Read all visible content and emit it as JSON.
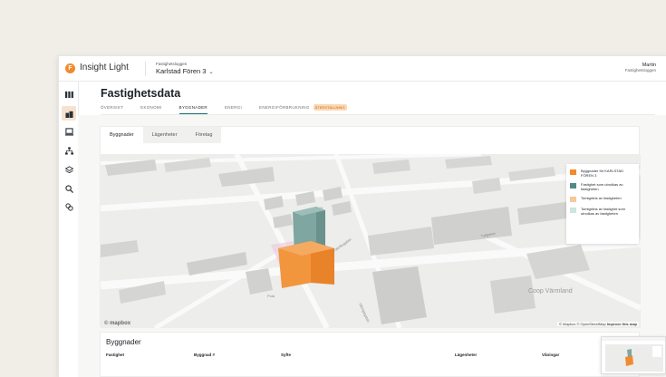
{
  "app": {
    "name": "Insight Light",
    "logo_letter": "F"
  },
  "property": {
    "org": "Fastighetsloggen",
    "name": "Karlstad Fören 3"
  },
  "user": {
    "name": "Martin",
    "org": "Fastighetsloggen"
  },
  "page": {
    "title": "Fastighetsdata"
  },
  "tabs": [
    {
      "label": "ÖVERSIKT"
    },
    {
      "label": "EKONOMI"
    },
    {
      "label": "BYGGNADER",
      "active": true
    },
    {
      "label": "ENERGI"
    },
    {
      "label": "ENERGIFÖRBRUKNING"
    }
  ],
  "tab_badge": "ÅTERSTÄLLNING",
  "subtabs": [
    {
      "label": "Byggnader",
      "active": true
    },
    {
      "label": "Lägenheter"
    },
    {
      "label": "Företag"
    }
  ],
  "legend": [
    {
      "label": "Byggnader för KARLSTAD FÖREN 3",
      "color": "#f28a2e"
    },
    {
      "label": "Fastighet som utnolkas av fastigheten",
      "color": "#4e8c86"
    },
    {
      "label": "Tomtgräns av fastigheten",
      "color": "#f6c89a"
    },
    {
      "label": "Tomtgräns av fastighet som utnolkas av fastigheten",
      "color": "#cfe3df"
    }
  ],
  "map": {
    "attribution_prefix": "© Mapbox © OpenStreetMap",
    "attribution_link": "Improve this map",
    "place_label": "Coop Värmland",
    "mapbox_label": "mapbox",
    "street_labels": [
      "Fabriksgatan",
      "Tullgatan",
      "Vikingagatan",
      "Pola"
    ]
  },
  "buildings_table": {
    "title": "Byggnader",
    "columns": [
      "Fastighet",
      "Byggnad #",
      "Syfte",
      "Lägenheter",
      "Våningar"
    ]
  },
  "colors": {
    "accent": "#1a6f78",
    "brand": "#f28a2e"
  }
}
